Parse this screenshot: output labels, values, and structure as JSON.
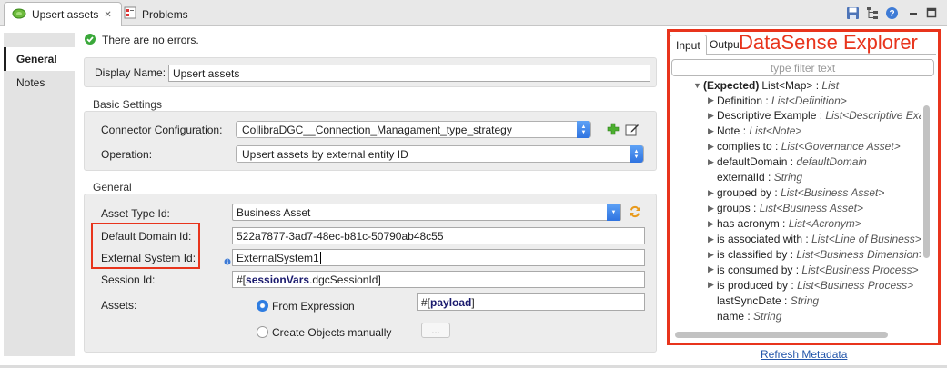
{
  "tabs": [
    {
      "label": "Upsert assets",
      "icon": "mule-config-icon",
      "active": true
    },
    {
      "label": "Problems",
      "icon": "problems-icon",
      "active": false
    }
  ],
  "toolbar_icons": [
    "save-icon",
    "tree-icon",
    "help-icon",
    "minimize-icon",
    "maximize-icon"
  ],
  "left_tabs": [
    "General",
    "Notes"
  ],
  "status": {
    "text": "There are no errors.",
    "icon": "check-circle-icon",
    "color": "#3aa83a"
  },
  "display_name": {
    "label": "Display Name:",
    "value": "Upsert assets"
  },
  "basic_settings": {
    "title": "Basic Settings",
    "connector_label": "Connector Configuration:",
    "connector_value": "CollibraDGC__Connection_Managament_type_strategy",
    "operation_label": "Operation:",
    "operation_value": "Upsert assets by external entity ID"
  },
  "general": {
    "title": "General",
    "asset_type_label": "Asset Type Id:",
    "asset_type_value": "Business Asset",
    "default_domain_label": "Default Domain Id:",
    "default_domain_value": "522a7877-3ad7-48ec-b81c-50790ab48c55",
    "external_system_label": "External System Id:",
    "external_system_value": "ExternalSystem1",
    "session_label": "Session Id:",
    "session_prefix": "#[",
    "session_kw": "sessionVars",
    "session_suffix": ".dgcSessionId]",
    "assets_label": "Assets:",
    "from_expression_label": "From Expression",
    "expression_prefix": "#[",
    "expression_kw": "payload",
    "expression_suffix": "]",
    "create_objects_label": "Create Objects manually",
    "ellipsis_label": "..."
  },
  "datasense": {
    "tabs": [
      "Input",
      "Output"
    ],
    "active_tab": "Input",
    "heading": "DataSense Explorer",
    "filter_placeholder": "type filter text",
    "refresh_label": "Refresh Metadata",
    "accent": "#e8341c",
    "root": {
      "name": "(Expected)",
      "type_plain": "List<Map>",
      "sep": " : ",
      "type": "List"
    },
    "items": [
      {
        "name": "Definition",
        "type": "List<Definition>",
        "expandable": true
      },
      {
        "name": "Descriptive Example",
        "type": "List<Descriptive Exa",
        "expandable": true
      },
      {
        "name": "Note",
        "type": "List<Note>",
        "expandable": true
      },
      {
        "name": "complies to",
        "type": "List<Governance Asset>",
        "expandable": true
      },
      {
        "name": "defaultDomain",
        "type": "defaultDomain",
        "expandable": true
      },
      {
        "name": "externalId",
        "type": "String",
        "expandable": false
      },
      {
        "name": "grouped by",
        "type": "List<Business Asset>",
        "expandable": true
      },
      {
        "name": "groups",
        "type": "List<Business Asset>",
        "expandable": true
      },
      {
        "name": "has acronym",
        "type": "List<Acronym>",
        "expandable": true
      },
      {
        "name": "is associated with",
        "type": "List<Line of Business>",
        "expandable": true
      },
      {
        "name": "is classified by",
        "type": "List<Business Dimension>",
        "expandable": true
      },
      {
        "name": "is consumed by",
        "type": "List<Business Process>",
        "expandable": true
      },
      {
        "name": "is produced by",
        "type": "List<Business Process>",
        "expandable": true
      },
      {
        "name": "lastSyncDate",
        "type": "String",
        "expandable": false
      },
      {
        "name": "name",
        "type": "String",
        "expandable": false
      }
    ]
  }
}
